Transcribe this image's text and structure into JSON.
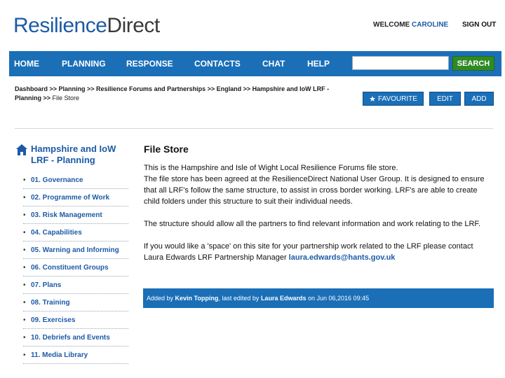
{
  "header": {
    "logo_part1": "Resilience",
    "logo_part2": "Direct",
    "welcome_label": "WELCOME",
    "user_name": "CAROLINE",
    "sign_out": "SIGN OUT"
  },
  "nav": {
    "items": [
      "HOME",
      "PLANNING",
      "RESPONSE",
      "CONTACTS",
      "CHAT",
      "HELP"
    ],
    "search_value": "",
    "search_button": "SEARCH"
  },
  "breadcrumb": {
    "line1": "Dashboard >> Planning >> Resilience Forums and Partnerships >> England >> Hampshire and IoW LRF -",
    "line2_prefix": "Planning >> ",
    "current": "File Store"
  },
  "actions": {
    "favourite": "FAVOURITE",
    "edit": "EDIT",
    "add": "ADD"
  },
  "sidebar": {
    "title": "Hampshire and IoW LRF - Planning",
    "items": [
      "01. Governance",
      "02. Programme of Work",
      "03. Risk Management",
      "04. Capabilities",
      "05. Warning and Informing",
      "06. Constituent Groups",
      "07. Plans",
      "08. Training",
      "09. Exercises",
      "10. Debriefs and Events",
      "11. Media Library"
    ]
  },
  "main": {
    "title": "File Store",
    "para1_line1": "This is the Hampshire and Isle of Wight Local Resilience Forums file store.",
    "para1_line2": "The file store has been agreed at the ResilienceDirect National User Group. It is designed to ensure that all LRF's follow the same structure, to assist in cross border working. LRF's are able to create child folders under this structure to suit their individual needs.",
    "para2": "The structure should allow all the partners to find relevant information and work relating to the LRF.",
    "para3_text": "If you would like a 'space' on this site for your partnership work related to the LRF please contact Laura Edwards LRF Partnership Manager",
    "email": "laura.edwards@hants.gov.uk"
  },
  "footer": {
    "added_by_label": "Added by",
    "added_by": "Kevin Topping",
    "edited_label": ", last edited by",
    "edited_by": "Laura Edwards",
    "on_label": "on",
    "date": "Jun 06,2016 09:45"
  }
}
